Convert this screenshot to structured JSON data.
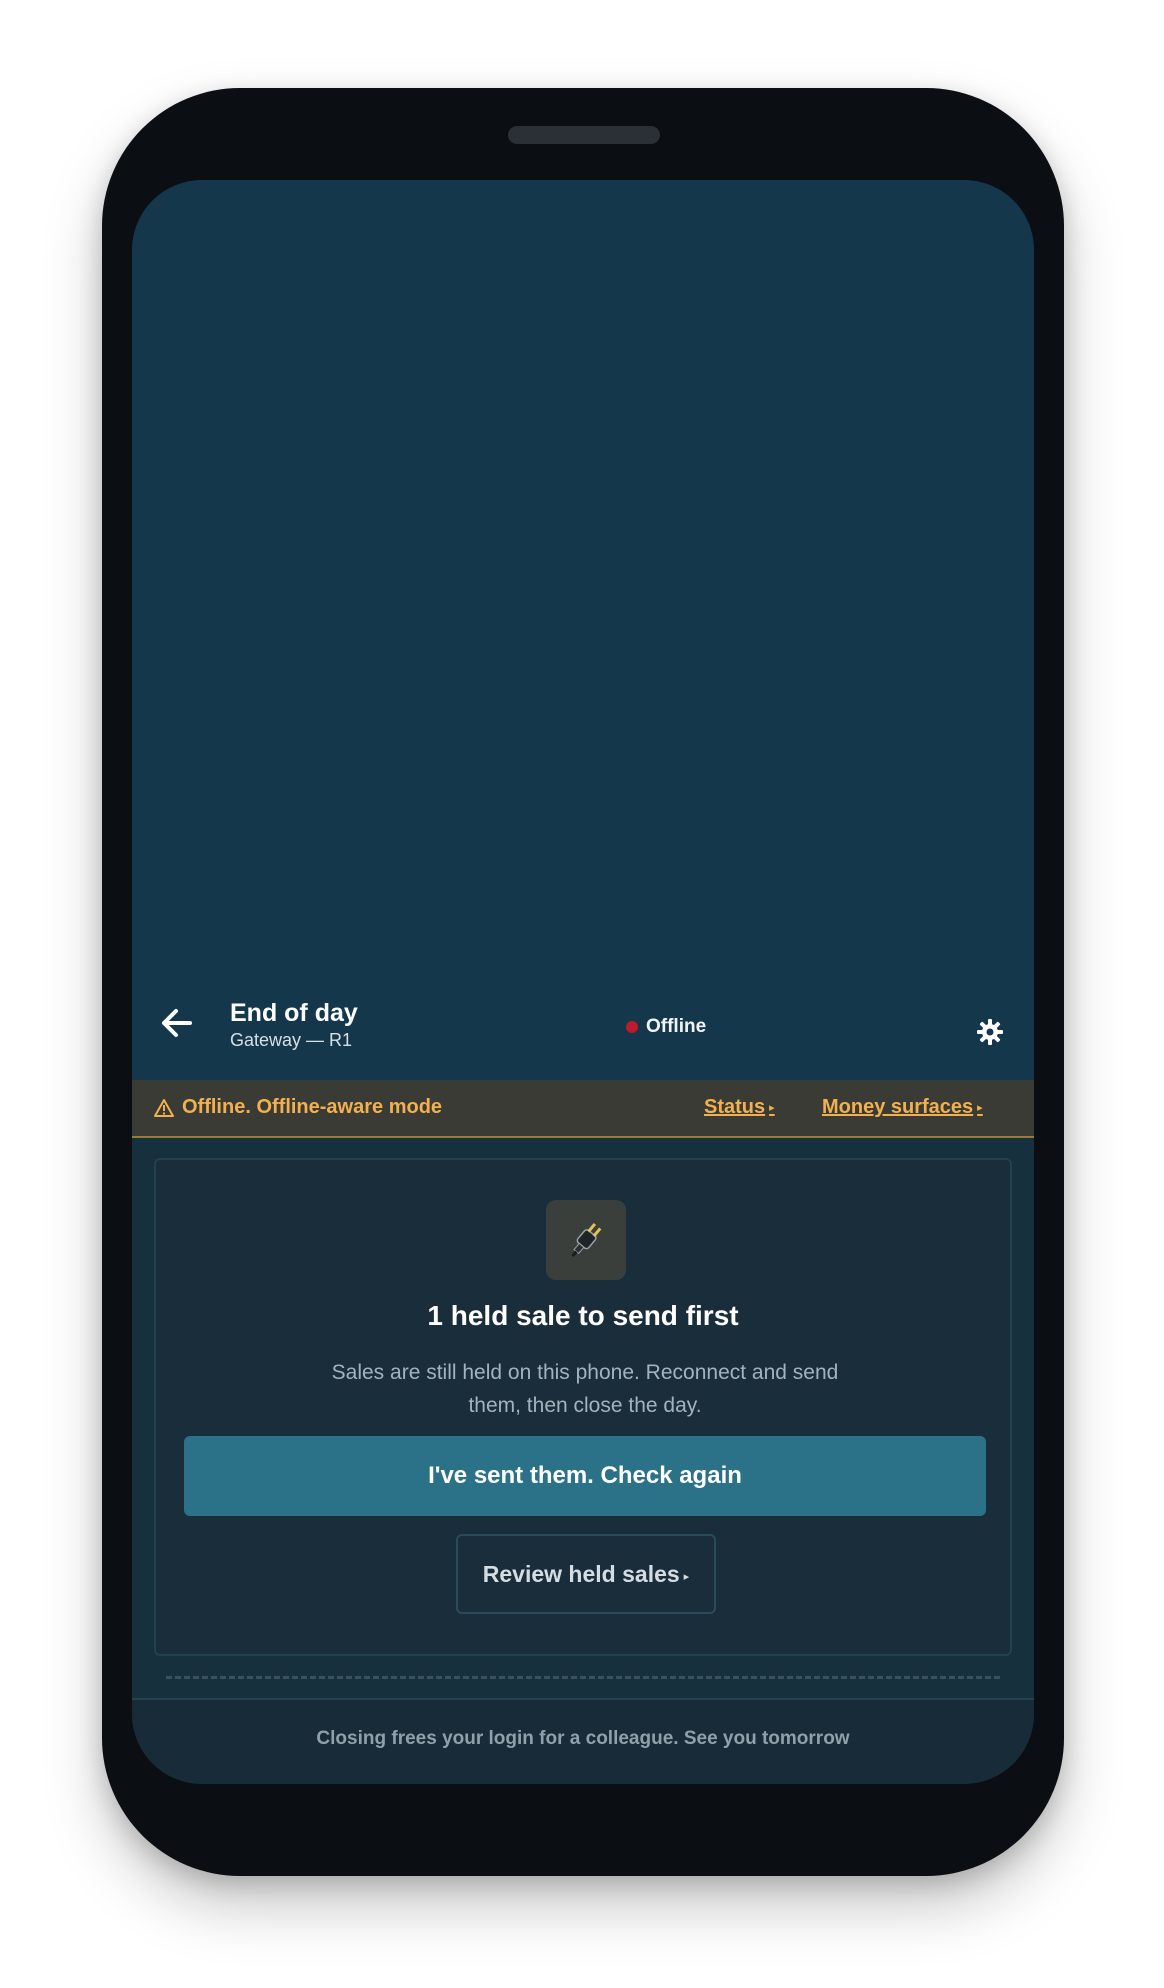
{
  "header": {
    "title": "End of day",
    "subtitle": "Gateway — R1",
    "status": "Offline",
    "status_color": "#c01a2c"
  },
  "banner": {
    "message": "Offline. Offline-aware mode",
    "links": [
      {
        "label": "Status"
      },
      {
        "label": "Money surfaces"
      }
    ],
    "color": "#f2b050"
  },
  "card": {
    "icon": "plug-icon",
    "title": "1 held sale to send first",
    "description": "Sales are still held on this phone. Reconnect and send them, then close the day.",
    "primary_button": "I've sent them. Check again",
    "secondary_button": "Review held sales"
  },
  "footer": {
    "text": "Closing frees your login for a colleague. See you tomorrow"
  },
  "colors": {
    "accent": "#2b7188",
    "header_bg": "#14374c",
    "warning": "#f2b050"
  }
}
